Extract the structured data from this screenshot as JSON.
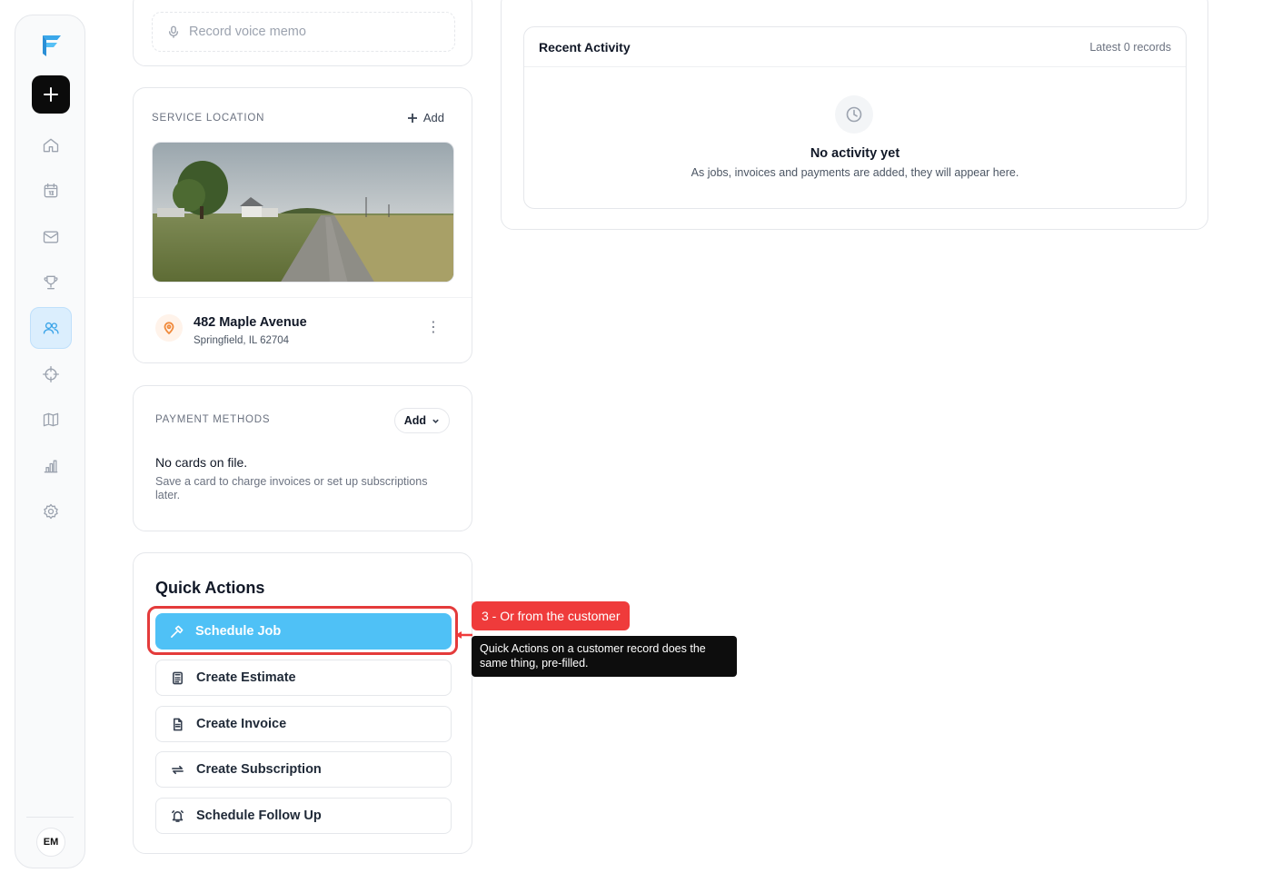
{
  "sidebar": {
    "nav_icons": [
      "home-icon",
      "calendar-icon",
      "mail-icon",
      "trophy-icon",
      "users-icon",
      "crosshair-icon",
      "map-icon",
      "bar-chart-icon",
      "gear-icon"
    ],
    "active": "users-icon",
    "avatar": "EM"
  },
  "voice_memo": {
    "placeholder": "Record voice memo"
  },
  "service_location": {
    "label": "SERVICE LOCATION",
    "add_label": "Add",
    "address_line1": "482 Maple Avenue",
    "address_line2": "Springfield, IL 62704"
  },
  "payment_methods": {
    "label": "PAYMENT METHODS",
    "add_label": "Add",
    "empty_title": "No cards on file.",
    "empty_help": "Save a card to charge invoices or set up subscriptions later."
  },
  "quick_actions": {
    "title": "Quick Actions",
    "buttons": [
      {
        "label": "Schedule Job",
        "icon": "hammer-icon"
      },
      {
        "label": "Create Estimate",
        "icon": "calculator-icon"
      },
      {
        "label": "Create Invoice",
        "icon": "document-icon"
      },
      {
        "label": "Create Subscription",
        "icon": "repeat-icon"
      },
      {
        "label": "Schedule Follow Up",
        "icon": "bell-icon"
      }
    ]
  },
  "annotation": {
    "tag": "3 - Or from the customer",
    "tooltip": "Quick Actions on a customer record does the same thing, pre-filled."
  },
  "recent_activity": {
    "title": "Recent Activity",
    "latest": "Latest 0 records",
    "empty_title": "No activity yet",
    "empty_text": "As jobs, invoices and payments are added, they will appear here."
  },
  "colors": {
    "primary": "#4fc1f6",
    "annotation_red": "#ef3b3b",
    "active_nav_bg": "#dbeefd",
    "pin_orange": "#f08a3c"
  }
}
